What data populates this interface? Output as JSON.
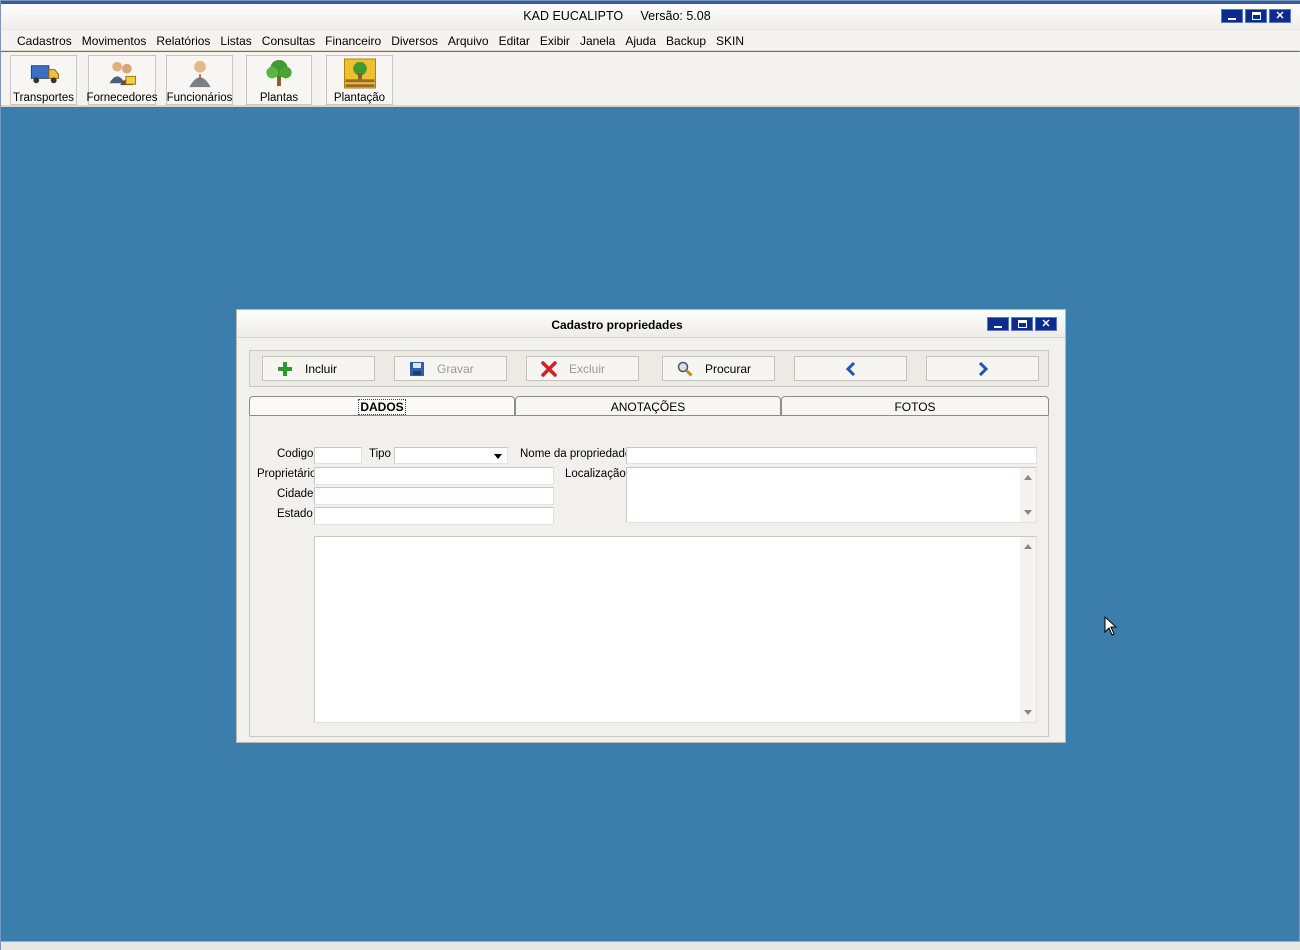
{
  "app": {
    "title": "KAD EUCALIPTO",
    "version": "Versão: 5.08"
  },
  "menu": [
    "Cadastros",
    "Movimentos",
    "Relatórios",
    "Listas",
    "Consultas",
    "Financeiro",
    "Diversos",
    "Arquivo",
    "Editar",
    "Exibir",
    "Janela",
    "Ajuda",
    "Backup",
    "SKIN"
  ],
  "toolbar": {
    "transportes": "Transportes",
    "fornecedores": "Fornecedores",
    "funcionarios": "Funcionários",
    "plantas": "Plantas",
    "plantacao": "Plantação"
  },
  "dialog": {
    "title": "Cadastro propriedades",
    "actions": {
      "incluir": "Incluir",
      "gravar": "Gravar",
      "excluir": "Excluir",
      "procurar": "Procurar"
    },
    "tabs": [
      "DADOS",
      "ANOTAÇÕES",
      "FOTOS"
    ],
    "fields": {
      "codigo_label": "Codigo",
      "tipo_label": "Tipo",
      "nome_label": "Nome da propriedade",
      "proprietario_label": "Proprietário",
      "localizacao_label": "Localização",
      "cidade_label": "Cidade",
      "estado_label": "Estado",
      "codigo_value": "",
      "tipo_value": "",
      "nome_value": "",
      "proprietario_value": "",
      "cidade_value": "",
      "estado_value": ""
    }
  },
  "colors": {
    "desktop": "#3b7dab",
    "window_button": "#0d2a8f"
  }
}
